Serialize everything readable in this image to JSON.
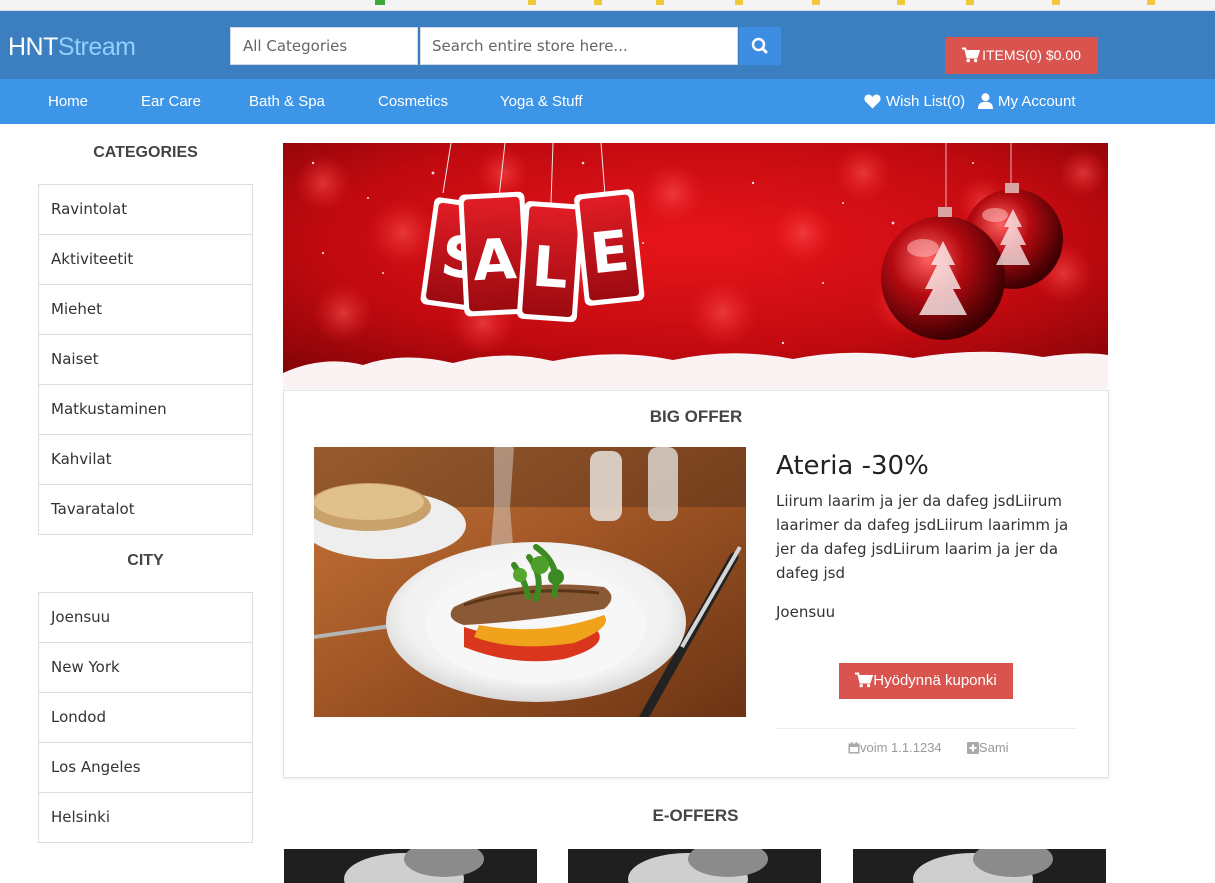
{
  "header": {
    "logo_part1": "HNT",
    "logo_part2": "Stream",
    "category_select": "All Categories",
    "search_placeholder": "Search entire store here...",
    "search_icon": "search-icon",
    "cart_label": "ITEMS(0) $0.00",
    "colors": {
      "header_bg": "#3c7fc0",
      "nav_bg": "#3d95e8",
      "accent_red": "#d9534f",
      "search_btn": "#3d8ee3"
    }
  },
  "nav": {
    "items": [
      "Home",
      "Ear Care",
      "Bath & Spa",
      "Cosmetics",
      "Yoga & Stuff"
    ],
    "wishlist": "Wish List(0)",
    "account": "My Account"
  },
  "sidebar": {
    "categories_title": "CATEGORIES",
    "categories": [
      "Ravintolat",
      "Aktiviteetit",
      "Miehet",
      "Naiset",
      "Matkustaminen",
      "Kahvilat",
      "Tavaratalot"
    ],
    "city_title": "CITY",
    "cities": [
      "Joensuu",
      "New York",
      "Londod",
      "Los Angeles",
      "Helsinki"
    ]
  },
  "banner": {
    "letters": [
      "S",
      "A",
      "L",
      "E"
    ]
  },
  "offer": {
    "section_title": "BIG OFFER",
    "name": "Ateria -30%",
    "description": "Liirum laarim ja jer da dafeg jsdLiirum laarimer da dafeg jsdLiirum laarimm ja jer da dafeg jsdLiirum laarim ja jer da dafeg jsd",
    "city": "Joensuu",
    "coupon_button": "Hyödynnä kuponki",
    "valid": "voim 1.1.1234",
    "author": "Sami"
  },
  "eoffers": {
    "section_title": "E-OFFERS"
  }
}
